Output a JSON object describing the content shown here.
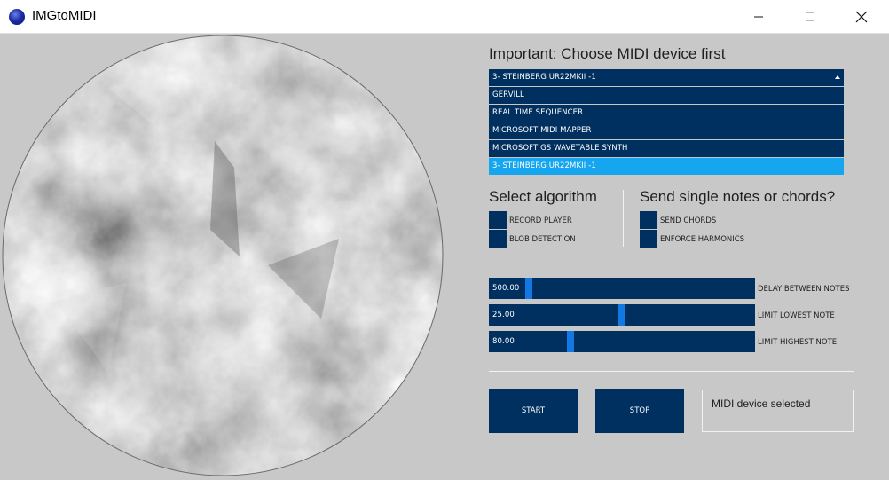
{
  "window": {
    "title": "IMGtoMIDI",
    "icon": "app-logo-icon"
  },
  "main": {
    "image": {
      "description_icon": "image-preview"
    },
    "midi": {
      "heading": "Important: Choose MIDI device first",
      "selected": "3- STEINBERG UR22MKII -1",
      "options": [
        {
          "label": "GERVILL",
          "active": false
        },
        {
          "label": "REAL TIME SEQUENCER",
          "active": false
        },
        {
          "label": "MICROSOFT MIDI MAPPER",
          "active": false
        },
        {
          "label": "MICROSOFT GS WAVETABLE SYNTH",
          "active": false
        },
        {
          "label": "3- STEINBERG UR22MKII -1",
          "active": true
        }
      ]
    },
    "algorithm": {
      "heading": "Select algorithm",
      "options": [
        "RECORD PLAYER",
        "BLOB DETECTION"
      ]
    },
    "notes": {
      "heading": "Send single notes or chords?",
      "options": [
        "SEND CHORDS",
        "ENFORCE HARMONICS"
      ]
    },
    "sliders": [
      {
        "value": "500.00",
        "label": "DELAY BETWEEN NOTES",
        "fraction": 0.14
      },
      {
        "value": "25.00",
        "label": "LIMIT LOWEST NOTE",
        "fraction": 0.5
      },
      {
        "value": "80.00",
        "label": "LIMIT HIGHEST NOTE",
        "fraction": 0.3
      }
    ],
    "buttons": {
      "start": "START",
      "stop": "STOP"
    },
    "status": "MIDI device selected"
  },
  "colors": {
    "navy": "#00305f",
    "highlight": "#15a6ef",
    "handle": "#1278e2",
    "background": "#c8c8c8"
  }
}
